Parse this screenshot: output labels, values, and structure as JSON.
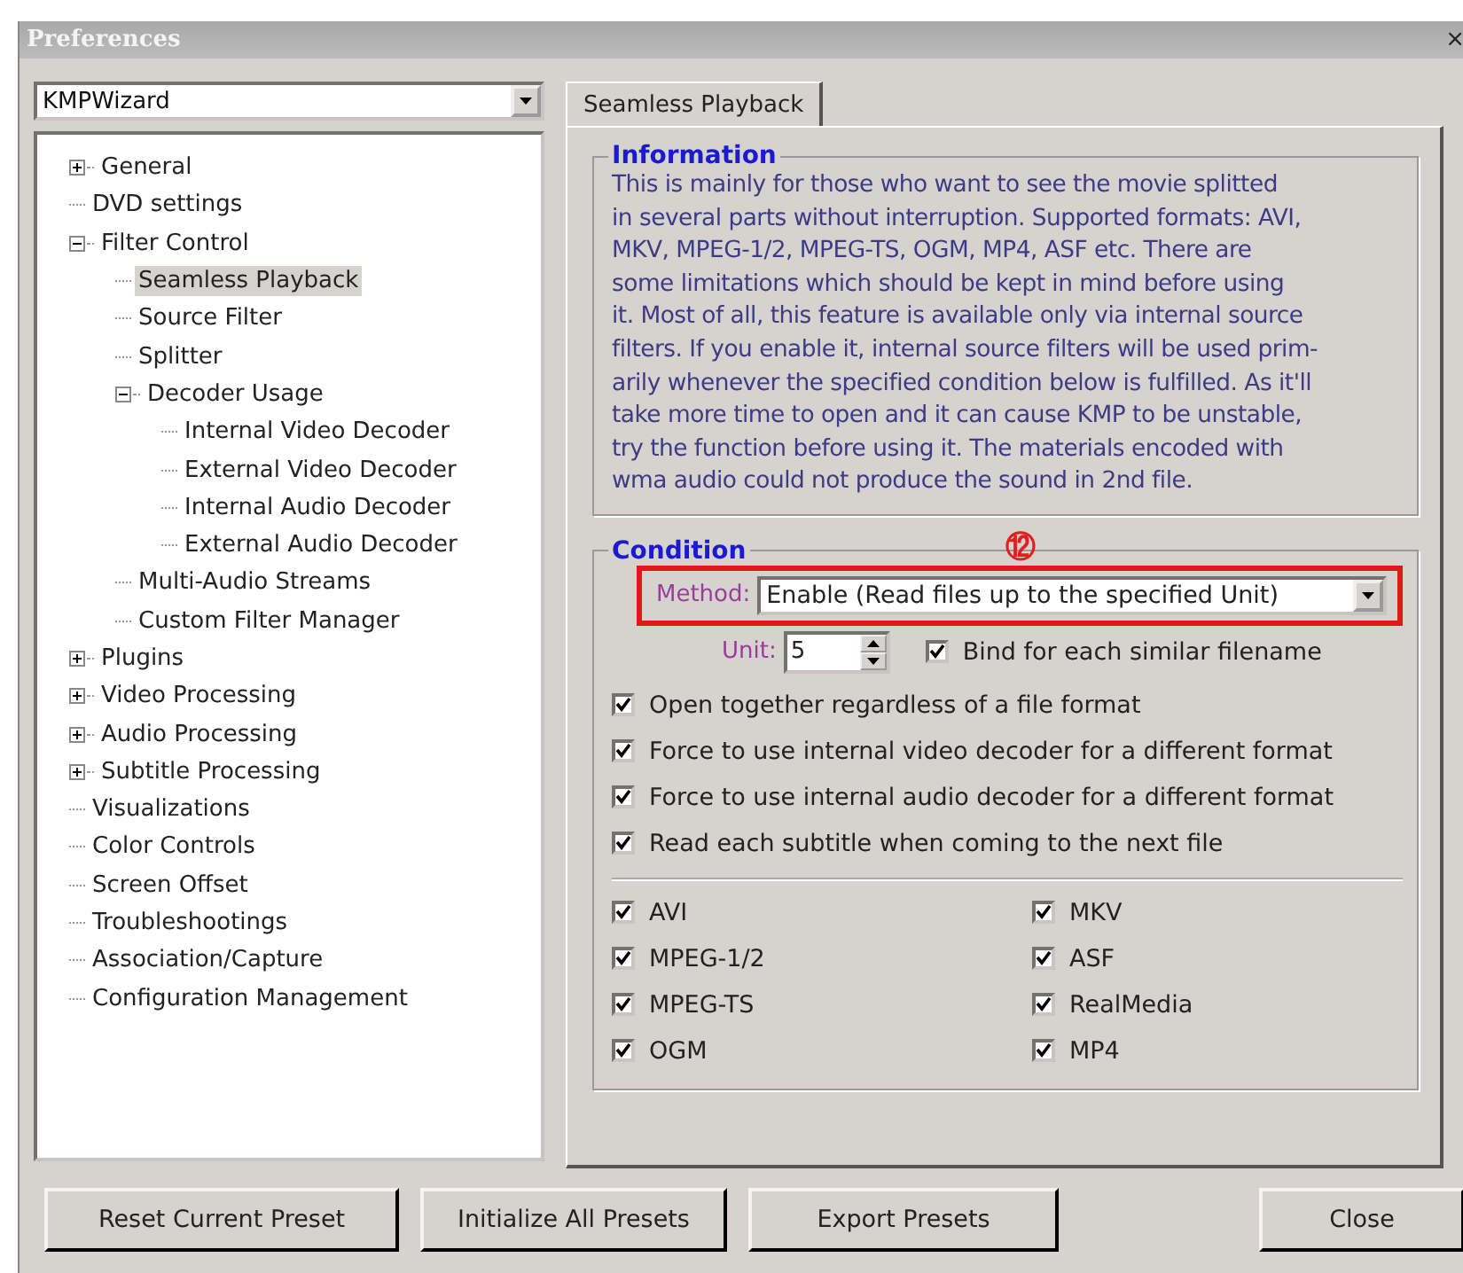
{
  "window": {
    "title": "Preferences",
    "close": "×"
  },
  "preset": {
    "value": "KMPWizard"
  },
  "tree": [
    {
      "label": "General",
      "expanded": false,
      "selected": false
    },
    {
      "label": "DVD settings",
      "selected": false
    },
    {
      "label": "Filter Control",
      "expanded": true,
      "selected": false,
      "children": [
        {
          "label": "Seamless Playback",
          "selected": true
        },
        {
          "label": "Source Filter",
          "selected": false
        },
        {
          "label": "Splitter",
          "selected": false
        },
        {
          "label": "Decoder Usage",
          "expanded": true,
          "selected": false,
          "children": [
            {
              "label": "Internal Video Decoder",
              "selected": false
            },
            {
              "label": "External Video Decoder",
              "selected": false
            },
            {
              "label": "Internal Audio Decoder",
              "selected": false
            },
            {
              "label": "External Audio Decoder",
              "selected": false
            }
          ]
        },
        {
          "label": "Multi-Audio Streams",
          "selected": false
        },
        {
          "label": "Custom Filter Manager",
          "selected": false
        }
      ]
    },
    {
      "label": "Plugins",
      "expanded": false,
      "selected": false
    },
    {
      "label": "Video Processing",
      "expanded": false,
      "selected": false
    },
    {
      "label": "Audio Processing",
      "expanded": false,
      "selected": false
    },
    {
      "label": "Subtitle Processing",
      "expanded": false,
      "selected": false
    },
    {
      "label": "Visualizations",
      "selected": false
    },
    {
      "label": "Color Controls",
      "selected": false
    },
    {
      "label": "Screen Offset",
      "selected": false
    },
    {
      "label": "Troubleshootings",
      "selected": false
    },
    {
      "label": "Association/Capture",
      "selected": false
    },
    {
      "label": "Configuration Management",
      "selected": false
    }
  ],
  "tabs": [
    {
      "label": "Seamless Playback",
      "selected": true
    }
  ],
  "information": {
    "title": "Information",
    "text": "This is mainly for those who want to see the movie splitted\nin several parts without interruption. Supported formats: AVI,\nMKV, MPEG-1/2, MPEG-TS, OGM, MP4, ASF etc. There are\nsome limitations which should be kept in mind before using\nit. Most of all, this feature is available only via internal source\nfilters. If you enable it, internal source filters will be used prim-\narily whenever the specified condition below is fulfilled. As it'll\ntake more time to open and it can cause KMP to be unstable,\ntry the function before using it. The materials encoded with\nwma audio could not produce the sound in 2nd file."
  },
  "condition": {
    "title": "Condition",
    "annotation": "⑫",
    "method": {
      "label": "Method:",
      "value": "Enable (Read files up to the specified Unit)",
      "highlighted": true
    },
    "unit": {
      "label": "Unit:",
      "value": "5"
    },
    "bind": {
      "label": "Bind for each similar filename",
      "checked": true
    },
    "options": [
      {
        "label": "Open together regardless of a file format",
        "checked": true
      },
      {
        "label": "Force to use internal video decoder for a different format",
        "checked": true
      },
      {
        "label": "Force to use internal audio decoder for a different format",
        "checked": true
      },
      {
        "label": "Read each subtitle when coming to the next file",
        "checked": true
      }
    ],
    "formats": [
      {
        "label": "AVI",
        "checked": true
      },
      {
        "label": "MKV",
        "checked": true
      },
      {
        "label": "MPEG-1/2",
        "checked": true
      },
      {
        "label": "ASF",
        "checked": true
      },
      {
        "label": "MPEG-TS",
        "checked": true
      },
      {
        "label": "RealMedia",
        "checked": true
      },
      {
        "label": "OGM",
        "checked": true
      },
      {
        "label": "MP4",
        "checked": true
      }
    ]
  },
  "buttons": [
    {
      "label": "Reset Current Preset",
      "kind": "left"
    },
    {
      "label": "Initialize All Presets",
      "kind": "left"
    },
    {
      "label": "Export Presets",
      "kind": "left"
    },
    {
      "label": "Close",
      "kind": "right"
    }
  ]
}
